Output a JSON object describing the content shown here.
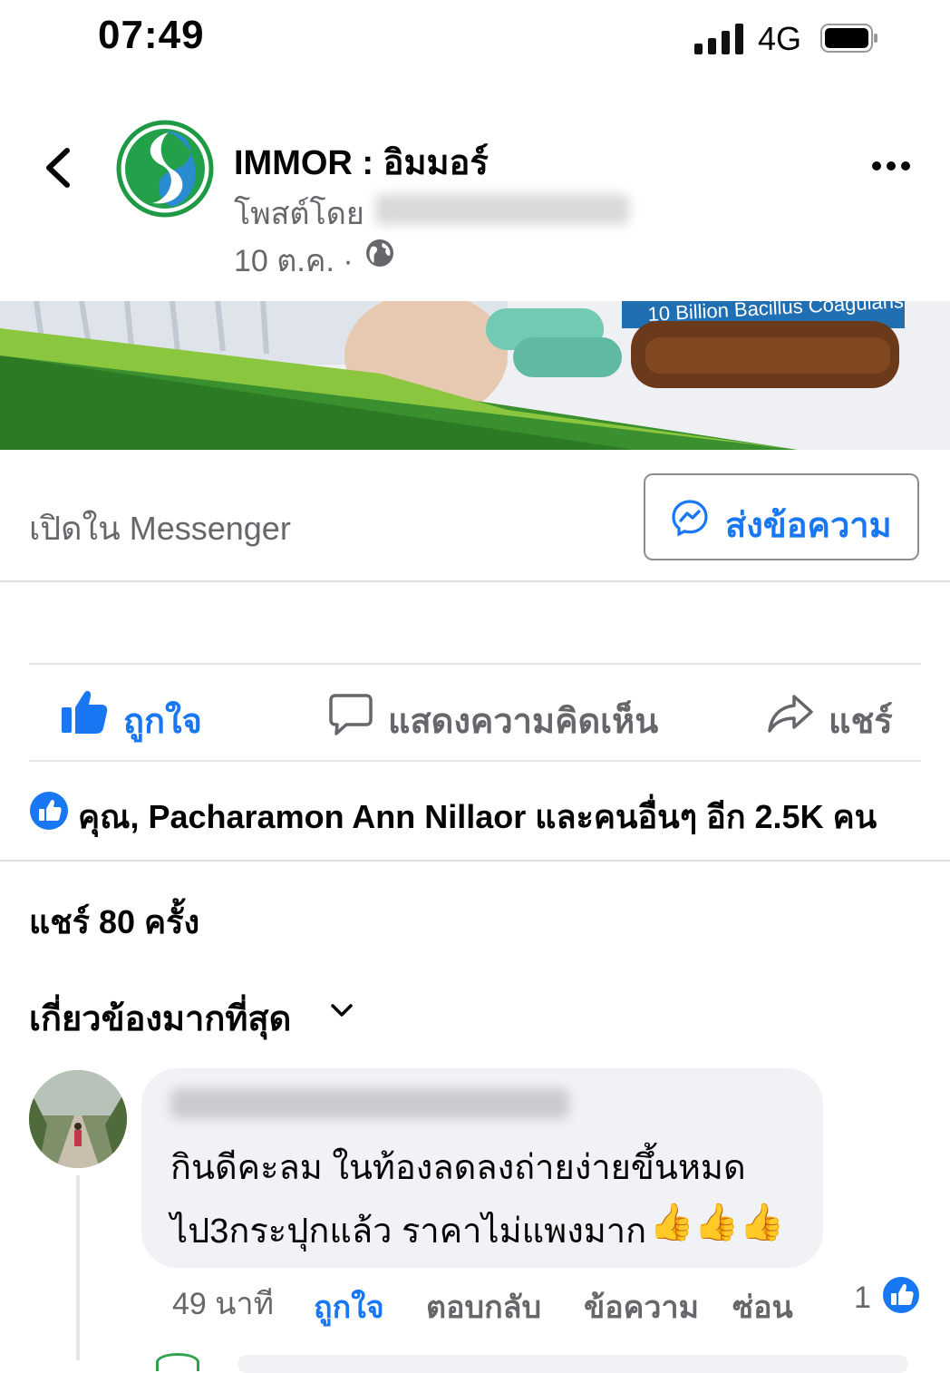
{
  "status_bar": {
    "time": "07:49",
    "network": "4G"
  },
  "post": {
    "page_name": "IMMOR : อิมมอร์",
    "posted_by_prefix": "โพสต์โดย",
    "date": "10 ต.ค. ·",
    "banner_text": "10 Billion Bacillus Coagulans"
  },
  "messenger": {
    "open_label": "เปิดใน Messenger",
    "send_label": "ส่งข้อความ"
  },
  "actions": {
    "like": "ถูกใจ",
    "comment": "แสดงความคิดเห็น",
    "share": "แชร์"
  },
  "reactions_text": "คุณ, Pacharamon Ann Nillaor และคนอื่นๆ อีก 2.5K คน",
  "shares_text": "แชร์ 80 ครั้ง",
  "sort_label": "เกี่ยวข้องมากที่สุด",
  "comment": {
    "line1": "กินดีคะลม ในท้องลดลงถ่ายง่ายขึ้นหมด",
    "line2": "ไป3กระปุกแล้ว ราคาไม่แพงมาก",
    "emoji": "👍👍👍",
    "time": "49 นาที",
    "like": "ถูกใจ",
    "reply": "ตอบกลับ",
    "message": "ข้อความ",
    "hide": "ซ่อน",
    "like_count": "1"
  },
  "colors": {
    "accent": "#1877f2",
    "secondary_text": "#65676b",
    "bubble": "#f0f2f5",
    "brand_green": "#2e9a3e"
  }
}
